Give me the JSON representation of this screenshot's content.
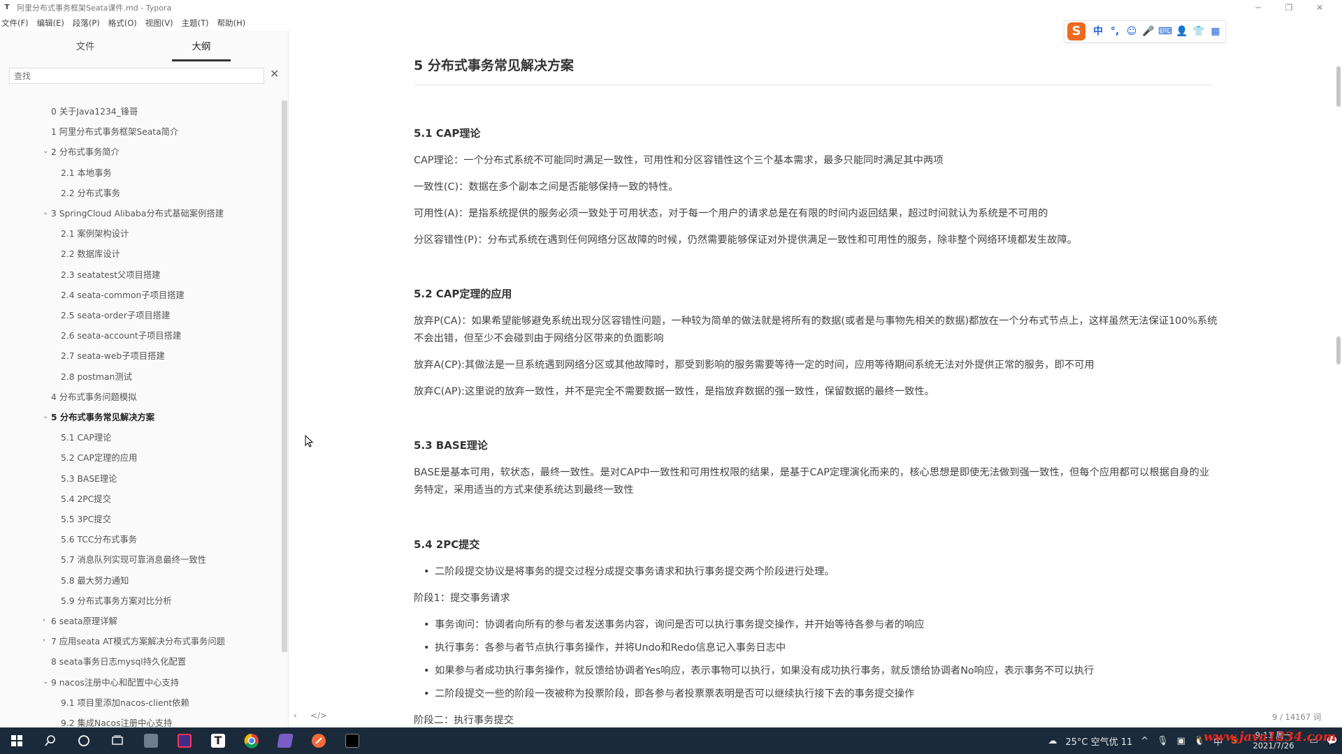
{
  "window": {
    "title": "阿里分布式事务框架Seata课件.md - Typora",
    "app_icon": "T",
    "controls": [
      "─",
      "❐",
      "✕"
    ]
  },
  "menu": [
    "文件(F)",
    "编辑(E)",
    "段落(P)",
    "格式(O)",
    "视图(V)",
    "主题(T)",
    "帮助(H)"
  ],
  "ime": {
    "logo": "S",
    "items": [
      "中",
      "°,",
      "☺",
      "🎤",
      "⌨",
      "👤",
      "👕",
      "▦"
    ]
  },
  "sidebar": {
    "tabs": [
      "文件",
      "大纲"
    ],
    "search_placeholder": "查找",
    "close": "✕",
    "nav_prev": "‹",
    "nav_source": "</>"
  },
  "toc": [
    {
      "label": "0 关于Java1234_锋哥",
      "level": 1,
      "arrow": ""
    },
    {
      "label": "1 阿里分布式事务框架Seata简介",
      "level": 1,
      "arrow": ""
    },
    {
      "label": "2 分布式事务简介",
      "level": 1,
      "arrow": "⌄"
    },
    {
      "label": "2.1 本地事务",
      "level": 2,
      "arrow": ""
    },
    {
      "label": "2.2 分布式事务",
      "level": 2,
      "arrow": ""
    },
    {
      "label": "3 SpringCloud Alibaba分布式基础案例搭建",
      "level": 1,
      "arrow": "⌄"
    },
    {
      "label": "2.1 案例架构设计",
      "level": 2,
      "arrow": ""
    },
    {
      "label": "2.2 数据库设计",
      "level": 2,
      "arrow": ""
    },
    {
      "label": "2.3 seatatest父项目搭建",
      "level": 2,
      "arrow": ""
    },
    {
      "label": "2.4 seata-common子项目搭建",
      "level": 2,
      "arrow": ""
    },
    {
      "label": "2.5 seata-order子项目搭建",
      "level": 2,
      "arrow": ""
    },
    {
      "label": "2.6 seata-account子项目搭建",
      "level": 2,
      "arrow": ""
    },
    {
      "label": "2.7 seata-web子项目搭建",
      "level": 2,
      "arrow": ""
    },
    {
      "label": "2.8 postman测试",
      "level": 2,
      "arrow": ""
    },
    {
      "label": "4 分布式事务问题模拟",
      "level": 1,
      "arrow": ""
    },
    {
      "label": "5 分布式事务常见解决方案",
      "level": 1,
      "arrow": "⌄",
      "active": true
    },
    {
      "label": "5.1 CAP理论",
      "level": 2,
      "arrow": ""
    },
    {
      "label": "5.2 CAP定理的应用",
      "level": 2,
      "arrow": ""
    },
    {
      "label": "5.3 BASE理论",
      "level": 2,
      "arrow": ""
    },
    {
      "label": "5.4 2PC提交",
      "level": 2,
      "arrow": ""
    },
    {
      "label": "5.5 3PC提交",
      "level": 2,
      "arrow": ""
    },
    {
      "label": "5.6 TCC分布式事务",
      "level": 2,
      "arrow": ""
    },
    {
      "label": "5.7 消息队列实现可靠消息最终一致性",
      "level": 2,
      "arrow": ""
    },
    {
      "label": "5.8 最大努力通知",
      "level": 2,
      "arrow": ""
    },
    {
      "label": "5.9 分布式事务方案对比分析",
      "level": 2,
      "arrow": ""
    },
    {
      "label": "6 seata原理详解",
      "level": 1,
      "arrow": "›"
    },
    {
      "label": "7 应用seata AT模式方案解决分布式事务问题",
      "level": 1,
      "arrow": "›"
    },
    {
      "label": "8 seata事务日志mysql持久化配置",
      "level": 1,
      "arrow": ""
    },
    {
      "label": "9 nacos注册中心和配置中心支持",
      "level": 1,
      "arrow": "⌄"
    },
    {
      "label": "9.1 项目里添加nacos-client依赖",
      "level": 2,
      "arrow": ""
    },
    {
      "label": "9.2 集成Nacos注册中心支持",
      "level": 2,
      "arrow": ""
    }
  ],
  "doc": {
    "h1": "5 分布式事务常见解决方案",
    "sections": [
      {
        "h": "5.1 CAP理论"
      },
      {
        "h": "5.2 CAP定理的应用"
      },
      {
        "h": "5.3 BASE理论"
      },
      {
        "h": "5.4 2PC提交"
      }
    ],
    "cap": [
      "CAP理论：一个分布式系统不可能同时满足一致性，可用性和分区容错性这个三个基本需求，最多只能同时满足其中两项",
      "一致性(C)：数据在多个副本之间是否能够保持一致的特性。",
      "可用性(A)：是指系统提供的服务必须一致处于可用状态，对于每一个用户的请求总是在有限的时间内返回结果，超过时间就认为系统是不可用的",
      "分区容错性(P)：分布式系统在遇到任何网络分区故障的时候，仍然需要能够保证对外提供满足一致性和可用性的服务，除非整个网络环境都发生故障。"
    ],
    "capapp": [
      "放弃P(CA)：如果希望能够避免系统出现分区容错性问题，一种较为简单的做法就是将所有的数据(或者是与事物先相关的数据)都放在一个分布式节点上，这样虽然无法保证100%系统不会出错，但至少不会碰到由于网络分区带来的负面影响",
      "放弃A(CP):其做法是一旦系统遇到网络分区或其他故障时，那受到影响的服务需要等待一定的时间，应用等待期间系统无法对外提供正常的服务，即不可用",
      "放弃C(AP):这里说的放弃一致性，并不是完全不需要数据一致性，是指放弃数据的强一致性，保留数据的最终一致性。"
    ],
    "base": "BASE是基本可用，软状态，最终一致性。是对CAP中一致性和可用性权限的结果，是基于CAP定理演化而来的，核心思想是即使无法做到强一致性，但每个应用都可以根据自身的业务特定，采用适当的方式来使系统达到最终一致性",
    "pc_bullet1": "二阶段提交协议是将事务的提交过程分成提交事务请求和执行事务提交两个阶段进行处理。",
    "stage1": "阶段1：提交事务请求",
    "pc_bullets": [
      "事务询问：协调者向所有的参与者发送事务内容，询问是否可以执行事务提交操作，并开始等待各参与者的响应",
      "执行事务：各参与者节点执行事务操作，并将Undo和Redo信息记入事务日志中",
      "如果参与者成功执行事务操作，就反馈给协调者Yes响应，表示事物可以执行，如果没有成功执行事务，就反馈给协调者No响应，表示事务不可以执行",
      "二阶段提交一些的阶段一夜被称为投票阶段，即各参与者投票票表明是否可以继续执行接下去的事务提交操作"
    ],
    "stage2": "阶段二：执行事务提交"
  },
  "status": {
    "wordcount": "9 / 14167 词"
  },
  "taskbar": {
    "weather": "25°C 空气优 11",
    "time": "9:11 周一",
    "date": "2021/7/26",
    "ime_lang": "中",
    "watermark": "www.java1234.com"
  },
  "colors": {
    "sidebar_bg": "#fafafa",
    "taskbar_bg": "#1b2a3a",
    "ime_orange": "#f06a1e",
    "ime_blue": "#1c5fd6"
  }
}
